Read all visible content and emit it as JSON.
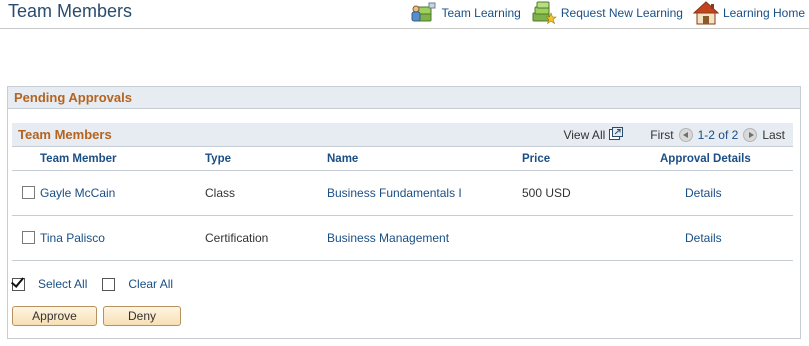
{
  "header": {
    "title": "Team Members",
    "links": [
      {
        "label": "Team Learning",
        "icon": "team-learning-icon"
      },
      {
        "label": "Request New Learning",
        "icon": "request-learning-icon"
      },
      {
        "label": "Learning Home",
        "icon": "home-icon"
      }
    ]
  },
  "pending": {
    "heading": "Pending Approvals",
    "grid": {
      "title": "Team Members",
      "view_all": "View All",
      "first": "First",
      "range": "1-2 of 2",
      "last": "Last",
      "columns": [
        "Team Member",
        "Type",
        "Name",
        "Price",
        "Approval Details"
      ],
      "rows": [
        {
          "member": "Gayle McCain",
          "type": "Class",
          "name": "Business Fundamentals I",
          "price": "500 USD",
          "details": "Details",
          "checked": false
        },
        {
          "member": "Tina Palisco",
          "type": "Certification",
          "name": "Business Management",
          "price": "",
          "details": "Details",
          "checked": false
        }
      ]
    },
    "select_all": "Select All",
    "clear_all": "Clear All",
    "buttons": {
      "approve": "Approve",
      "deny": "Deny"
    }
  },
  "colors": {
    "title_blue": "#2a4c6f",
    "link_blue": "#1a4f85",
    "section_orange": "#b5631f",
    "header_bg": "#e6ecf2",
    "button_bg": "#f7dfb3"
  }
}
